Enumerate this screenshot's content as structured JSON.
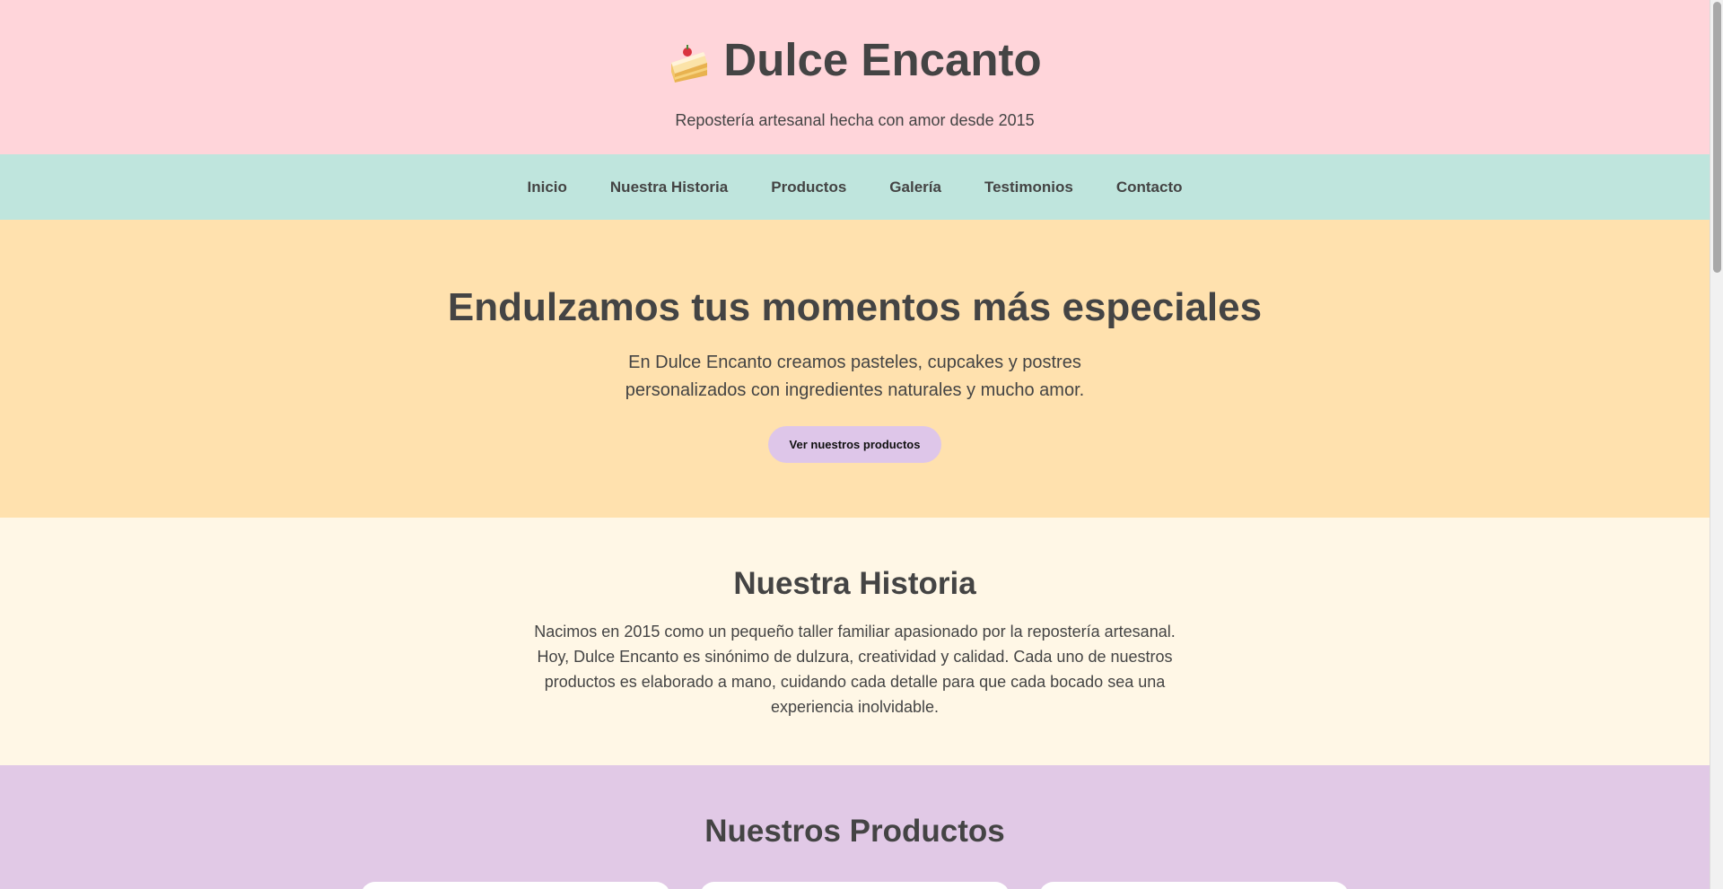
{
  "header": {
    "brand_icon": "cake-slice-icon",
    "brand_name": "Dulce Encanto",
    "tagline": "Repostería artesanal hecha con amor desde 2015"
  },
  "nav": {
    "items": [
      {
        "label": "Inicio"
      },
      {
        "label": "Nuestra Historia"
      },
      {
        "label": "Productos"
      },
      {
        "label": "Galería"
      },
      {
        "label": "Testimonios"
      },
      {
        "label": "Contacto"
      }
    ]
  },
  "hero": {
    "title": "Endulzamos tus momentos más especiales",
    "text": "En Dulce Encanto creamos pasteles, cupcakes y postres personalizados con ingredientes naturales y mucho amor.",
    "cta_label": "Ver nuestros productos"
  },
  "history": {
    "title": "Nuestra Historia",
    "text": "Nacimos en 2015 como un pequeño taller familiar apasionado por la repostería artesanal. Hoy, Dulce Encanto es sinónimo de dulzura, creatividad y calidad. Cada uno de nuestros productos es elaborado a mano, cuidando cada detalle para que cada bocado sea una experiencia inolvidable."
  },
  "products": {
    "title": "Nuestros Productos"
  },
  "colors": {
    "header_bg": "#ffd5da",
    "nav_bg": "#bfe5dd",
    "hero_bg": "#ffe1ae",
    "history_bg": "#fff7e6",
    "products_bg": "#e1c9e6",
    "cta_bg": "#dec6e9",
    "text": "#444444"
  }
}
